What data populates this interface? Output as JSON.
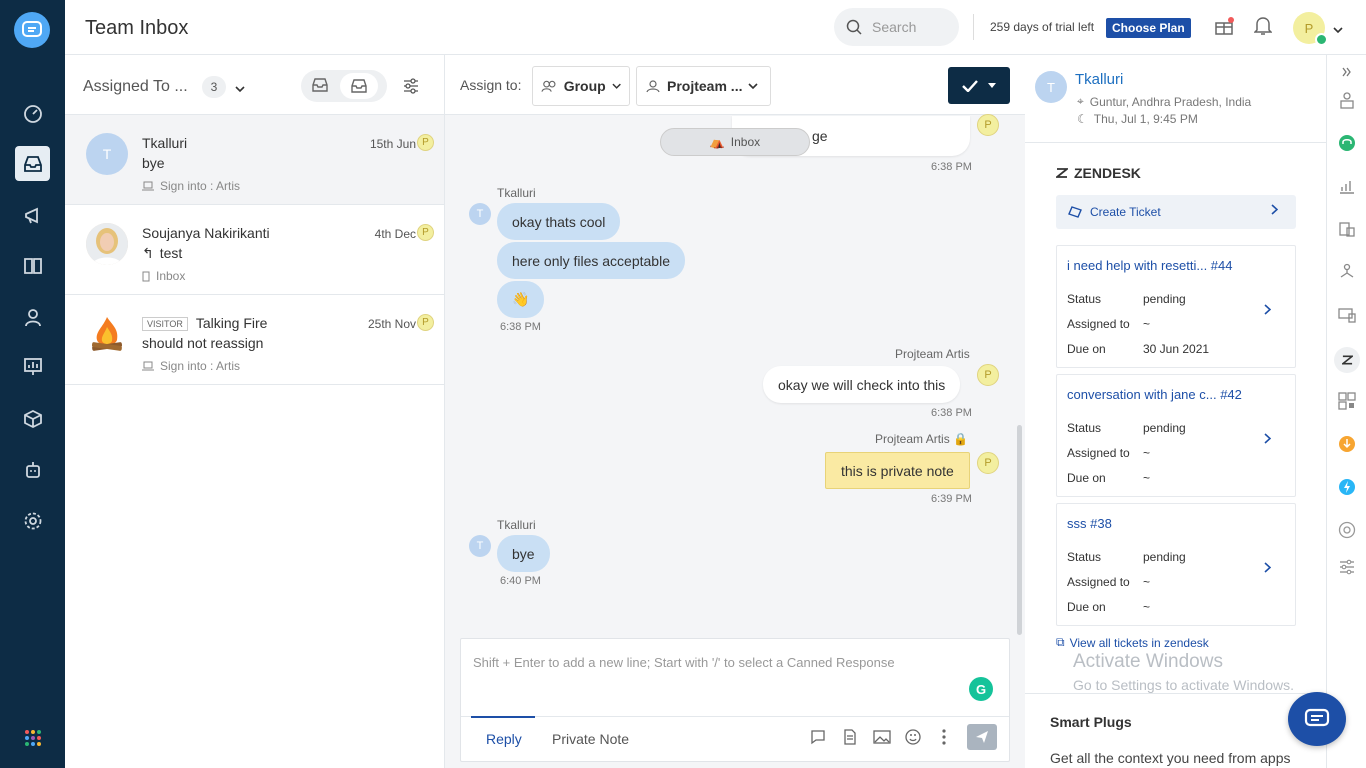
{
  "header": {
    "title": "Team Inbox",
    "search_placeholder": "Search",
    "trial_text": "259 days of trial left",
    "choose_plan": "Choose Plan",
    "user_initial": "P"
  },
  "list": {
    "filter_label": "Assigned To ...",
    "count": "3",
    "items": [
      {
        "name": "Tkalluri",
        "initial": "T",
        "message": "bye",
        "source": "Sign into : Artis",
        "date": "15th Jun",
        "badge": "P"
      },
      {
        "name": "Soujanya Nakirikanti",
        "message": "test",
        "source": "Inbox",
        "date": "4th Dec",
        "badge": "P"
      },
      {
        "tag": "VISITOR",
        "name": "Talking Fire",
        "message": "should not reassign",
        "source": "Sign into : Artis",
        "date": "25th Nov",
        "badge": "P"
      }
    ]
  },
  "chat": {
    "assign_label": "Assign to:",
    "group_label": "Group",
    "team_label": "Projteam ...",
    "inbox_pill": "Inbox",
    "messages": {
      "m0_text": "ge",
      "m0_time": "6:38 PM",
      "m0_badge": "P",
      "s1": "Tkalluri",
      "s1_initial": "T",
      "b1": "okay thats cool",
      "b2": "here only files acceptable",
      "b3": "👋",
      "t1": "6:38 PM",
      "s2": "Projteam Artis",
      "s2_badge": "P",
      "b4": "okay we will check into this",
      "t2": "6:38 PM",
      "s3": "Projteam Artis",
      "s3_badge": "P",
      "b5": "this is private note",
      "t3": "6:39 PM",
      "s4": "Tkalluri",
      "s4_initial": "T",
      "b6": "bye",
      "t4": "6:40 PM"
    },
    "composer": {
      "placeholder": "Shift + Enter to add a new line; Start with '/' to select a Canned Response",
      "reply_tab": "Reply",
      "note_tab": "Private Note",
      "grammarly": "G"
    }
  },
  "panel": {
    "user": {
      "name": "Tkalluri",
      "initial": "T",
      "location": "Guntur, Andhra Pradesh, India",
      "time": "Thu, Jul 1, 9:45 PM"
    },
    "zendesk_title": "ZENDESK",
    "create_ticket": "Create Ticket",
    "status_label": "Status",
    "assigned_label": "Assigned to",
    "due_label": "Due on",
    "tickets": [
      {
        "title": "i need help with resetti... #44",
        "status": "pending",
        "assigned": "~",
        "due": "30 Jun 2021"
      },
      {
        "title": "conversation with jane c... #42",
        "status": "pending",
        "assigned": "~",
        "due": "~"
      },
      {
        "title": "sss #38",
        "status": "pending",
        "assigned": "~",
        "due": "~"
      }
    ],
    "view_all": "View all tickets in zendesk",
    "watermark1": "Activate Windows",
    "watermark2": "Go to Settings to activate Windows.",
    "smart_title": "Smart Plugs",
    "smart_desc": "Get all the context you need from apps"
  },
  "colors": {
    "nav_bg": "#0d2c45",
    "accent": "#1d4fa7",
    "link": "#1d6fc0",
    "note_bg": "#faeaa3",
    "incoming_bubble": "#c9dff4"
  },
  "icons": [
    "chat-logo-icon",
    "dashboard-icon",
    "inbox-icon",
    "megaphone-icon",
    "book-icon",
    "contacts-icon",
    "reports-icon",
    "cube-icon",
    "bot-icon",
    "settings-icon",
    "apps-grid-icon"
  ]
}
